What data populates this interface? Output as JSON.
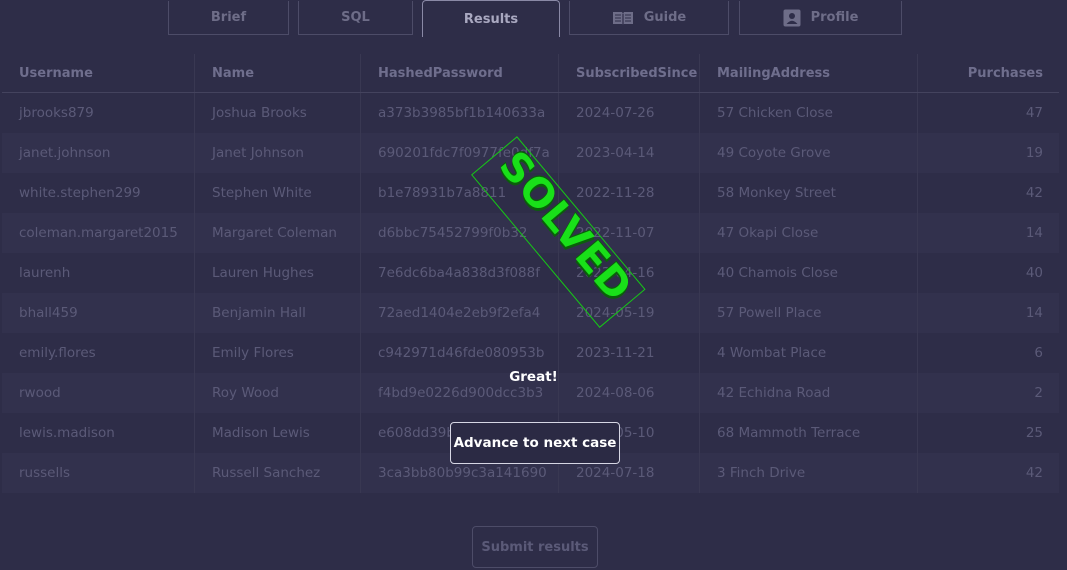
{
  "tabs": [
    {
      "label": "Brief",
      "icon": ""
    },
    {
      "label": "SQL",
      "icon": ""
    },
    {
      "label": "Results",
      "icon": "",
      "active": true
    },
    {
      "label": "Guide",
      "icon": "book-icon"
    },
    {
      "label": "Profile",
      "icon": "profile-card-icon"
    }
  ],
  "table": {
    "headers": [
      "Username",
      "Name",
      "HashedPassword",
      "SubscribedSince",
      "MailingAddress",
      "Purchases"
    ],
    "rows": [
      [
        "jbrooks879",
        "Joshua Brooks",
        "a373b3985bf1b140633a",
        "2024-07-26",
        "57 Chicken Close",
        "47"
      ],
      [
        "janet.johnson",
        "Janet Johnson",
        "690201fdc7f0977fe0df7a",
        "2023-04-14",
        "49 Coyote Grove",
        "19"
      ],
      [
        "white.stephen299",
        "Stephen White",
        "b1e78931b7a8811",
        "2022-11-28",
        "58 Monkey Street",
        "42"
      ],
      [
        "coleman.margaret2015",
        "Margaret Coleman",
        "d6bbc75452799f0b32",
        "2022-11-07",
        "47 Okapi Close",
        "14"
      ],
      [
        "laurenh",
        "Lauren Hughes",
        "7e6dc6ba4a838d3f088f",
        "2023-04-16",
        "40 Chamois Close",
        "40"
      ],
      [
        "bhall459",
        "Benjamin Hall",
        "72aed1404e2eb9f2efa4",
        "2024-05-19",
        "57 Powell Place",
        "14"
      ],
      [
        "emily.flores",
        "Emily Flores",
        "c942971d46fde080953b",
        "2023-11-21",
        "4 Wombat Place",
        "6"
      ],
      [
        "rwood",
        "Roy Wood",
        "f4bd9e0226d900dcc3b3",
        "2024-08-06",
        "42 Echidna Road",
        "2"
      ],
      [
        "lewis.madison",
        "Madison Lewis",
        "e608dd39b",
        "2024-05-10",
        "68 Mammoth Terrace",
        "25"
      ],
      [
        "russells",
        "Russell Sanchez",
        "3ca3bb80b99c3a141690",
        "2024-07-18",
        "3 Finch Drive",
        "42"
      ]
    ]
  },
  "stamp": {
    "text": "SOLVED",
    "color": "#19e019"
  },
  "message": "Great!",
  "advance_label": "Advance to next case",
  "submit_label": "Submit results"
}
